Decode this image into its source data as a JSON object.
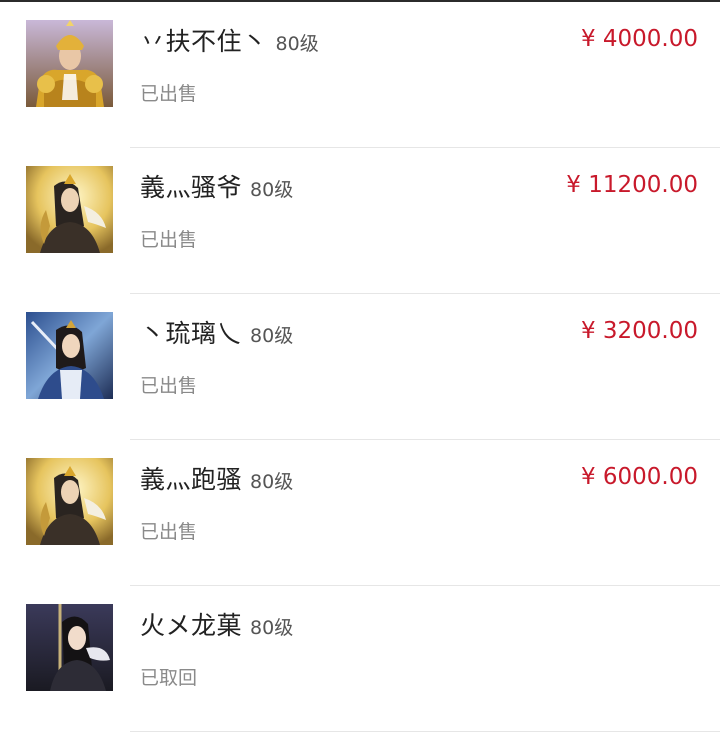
{
  "colors": {
    "price": "#c8192b",
    "name": "#222222",
    "status": "#8a8a8a"
  },
  "listings": [
    {
      "name": "丷扶不住丶",
      "level": "80级",
      "status": "已出售",
      "price": "¥ 4000.00",
      "avatar": "golden-armor-warrior-icon"
    },
    {
      "name": "義灬骚爷",
      "level": "80级",
      "status": "已出售",
      "price": "¥ 11200.00",
      "avatar": "golden-crowned-warrior-icon"
    },
    {
      "name": "丶琉璃乀",
      "level": "80级",
      "status": "已出售",
      "price": "¥ 3200.00",
      "avatar": "blue-robed-swordsman-icon"
    },
    {
      "name": "義灬跑骚",
      "level": "80级",
      "status": "已出售",
      "price": "¥ 6000.00",
      "avatar": "golden-crowned-warrior-icon"
    },
    {
      "name": "火メ龙菓",
      "level": "80级",
      "status": "已取回",
      "price": "",
      "avatar": "dark-haired-heroine-icon"
    }
  ]
}
